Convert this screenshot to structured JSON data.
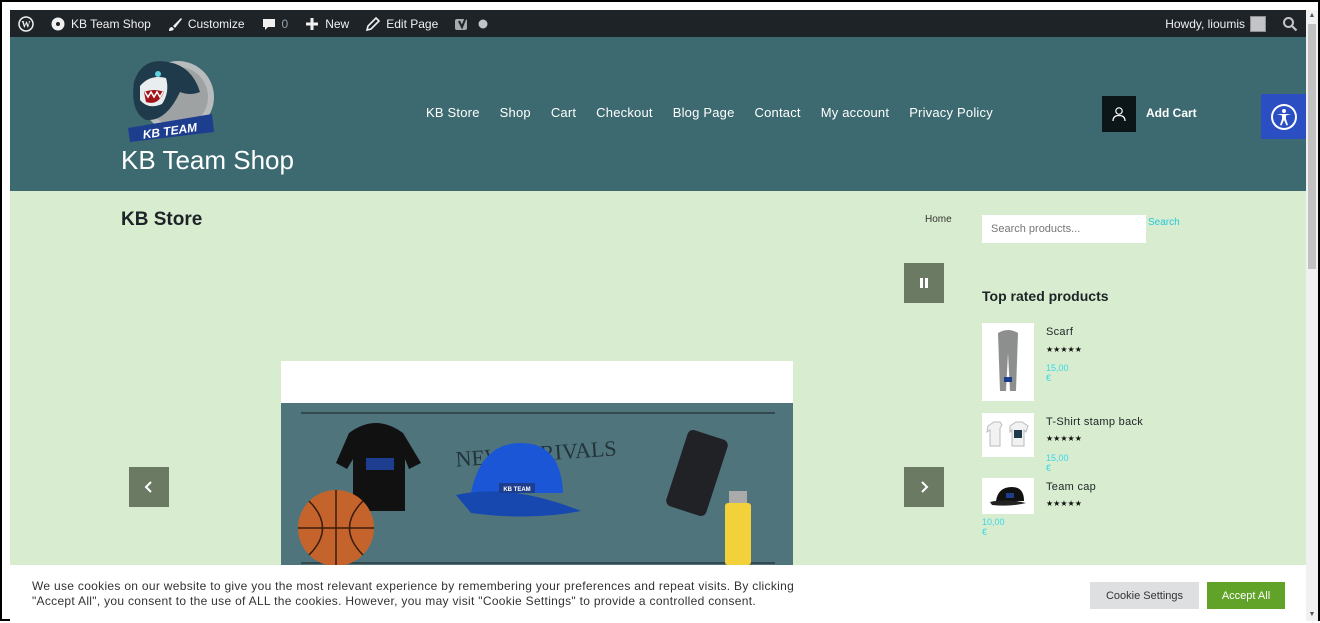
{
  "admin_bar": {
    "site_name": "KB Team Shop",
    "customize": "Customize",
    "comments_count": "0",
    "new": "New",
    "edit_page": "Edit Page",
    "howdy": "Howdy, lioumis"
  },
  "header": {
    "logo_text": "KB TEAM",
    "site_title": "KB Team Shop",
    "nav": [
      "KB Store",
      "Shop",
      "Cart",
      "Checkout",
      "Blog Page",
      "Contact",
      "My account",
      "Privacy Policy"
    ],
    "add_cart": "Add Cart"
  },
  "main": {
    "page_title": "KB Store",
    "breadcrumb": "Home",
    "slider": {
      "banner_text": "NEW ARRIVALS",
      "cap_text": "KB TEAM"
    }
  },
  "sidebar": {
    "search": {
      "placeholder": "Search products...",
      "button": "Search"
    },
    "top_rated_title": "Top rated products",
    "products": [
      {
        "name": "Scarf",
        "stars": "★★★★★",
        "price": "15,00 €",
        "rating": 5
      },
      {
        "name": "T-Shirt stamp back",
        "stars": "★★★★★",
        "price": "15,00 €",
        "rating": 5
      },
      {
        "name": "Team cap",
        "stars": "★★★★★",
        "price": "10,00 €",
        "rating": 5
      }
    ]
  },
  "cookie_bar": {
    "line1": "We use cookies on our website to give you the most relevant experience by remembering your preferences and repeat visits. By clicking",
    "line2": "\"Accept All\", you consent to the use of ALL the cookies. However, you may visit \"Cookie Settings\" to provide a controlled consent.",
    "settings_label": "Cookie Settings",
    "accept_label": "Accept All"
  },
  "colors": {
    "admin_bar": "#1d2327",
    "header": "#3c6a70",
    "content": "#d8edcf",
    "accent_price": "#3ad5e8",
    "accept": "#61a229",
    "accessibility": "#2b4ec2"
  },
  "icons": [
    "wordpress-icon",
    "dashboard-icon",
    "brush-icon",
    "comment-icon",
    "plus-icon",
    "pencil-icon",
    "yoast-icon",
    "dot-icon",
    "search-icon",
    "user-icon",
    "accessibility-icon",
    "pause-icon",
    "chevron-left-icon",
    "chevron-right-icon"
  ]
}
